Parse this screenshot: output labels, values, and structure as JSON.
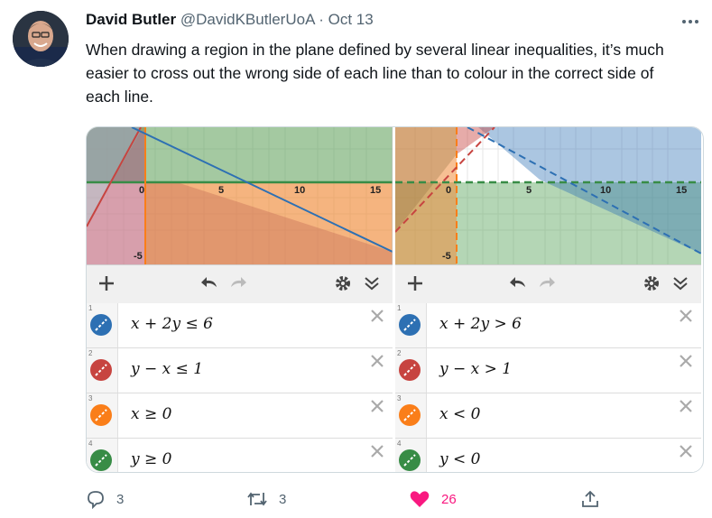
{
  "tweet": {
    "author_name": "David Butler",
    "handle": "@DavidKButlerUoA",
    "separator": "·",
    "date": "Oct 13",
    "text": "When drawing a region in the plane defined by several linear inequalities, it’s much easier to cross out the wrong side of each line than to colour in the correct side of each line."
  },
  "panels": {
    "left": {
      "axis_ticks": {
        "x": [
          "0",
          "5",
          "10",
          "15"
        ],
        "y": [
          "-5"
        ]
      },
      "expressions": [
        {
          "index": "1",
          "latex": "x + 2y ≤ 6",
          "color": "#2d70b3"
        },
        {
          "index": "2",
          "latex": "y − x ≤ 1",
          "color": "#c74440"
        },
        {
          "index": "3",
          "latex": "x ≥ 0",
          "color": "#fa7e19"
        },
        {
          "index": "4",
          "latex": "y ≥ 0",
          "color": "#388c46"
        }
      ]
    },
    "right": {
      "axis_ticks": {
        "x": [
          "0",
          "5",
          "10",
          "15"
        ],
        "y": [
          "-5"
        ]
      },
      "expressions": [
        {
          "index": "1",
          "latex": "x + 2y > 6",
          "color": "#2d70b3"
        },
        {
          "index": "2",
          "latex": "y − x > 1",
          "color": "#c74440"
        },
        {
          "index": "3",
          "latex": "x < 0",
          "color": "#fa7e19"
        },
        {
          "index": "4",
          "latex": "y < 0",
          "color": "#388c46"
        }
      ]
    }
  },
  "actions": {
    "reply_count": "3",
    "retweet_count": "3",
    "like_count": "26"
  },
  "icons": {
    "more": "more-dots-icon",
    "reply": "reply-icon",
    "retweet": "retweet-icon",
    "like": "heart-icon",
    "share": "share-icon",
    "add": "plus-icon",
    "undo": "undo-icon",
    "redo": "redo-icon",
    "settings": "gear-icon",
    "collapse": "double-chevron-icon",
    "delete": "close-icon"
  },
  "colors": {
    "like": "#f91880",
    "muted": "#536471"
  }
}
